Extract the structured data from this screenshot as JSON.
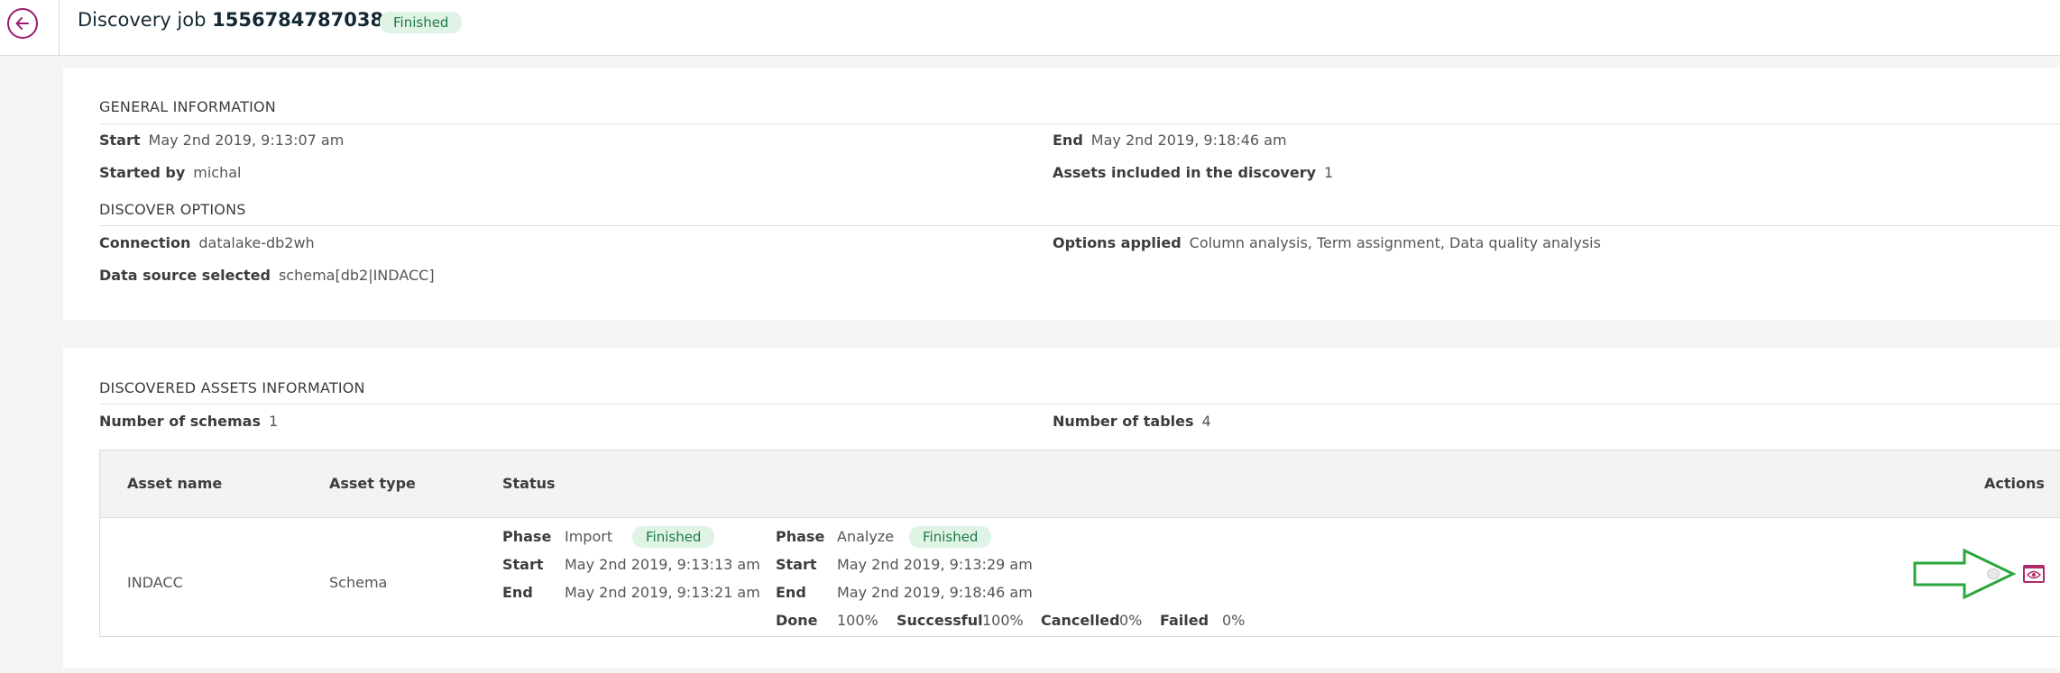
{
  "header": {
    "title_prefix": "Discovery job",
    "job_id": "1556784787038",
    "status": "Finished"
  },
  "general_information": {
    "heading": "GENERAL INFORMATION",
    "start_label": "Start",
    "start_value": "May 2nd 2019, 9:13:07 am",
    "end_label": "End",
    "end_value": "May 2nd 2019, 9:18:46 am",
    "started_by_label": "Started by",
    "started_by_value": "michal",
    "assets_included_label": "Assets included in the discovery",
    "assets_included_value": "1"
  },
  "discover_options": {
    "heading": "DISCOVER OPTIONS",
    "connection_label": "Connection",
    "connection_value": "datalake-db2wh",
    "options_applied_label": "Options applied",
    "options_applied_value": "Column analysis, Term assignment, Data quality analysis",
    "data_source_label": "Data source selected",
    "data_source_value": "schema[db2|INDACC]"
  },
  "discovered_assets": {
    "heading": "DISCOVERED ASSETS INFORMATION",
    "schemas_label": "Number of schemas",
    "schemas_value": "1",
    "tables_label": "Number of tables",
    "tables_value": "4"
  },
  "table": {
    "columns": [
      "Asset name",
      "Asset type",
      "Status",
      "Actions"
    ],
    "rows": [
      {
        "asset_name": "INDACC",
        "asset_type": "Schema",
        "import_phase": {
          "phase_label": "Phase",
          "phase_name": "Import",
          "status": "Finished",
          "start_label": "Start",
          "start_value": "May 2nd 2019, 9:13:13 am",
          "end_label": "End",
          "end_value": "May 2nd 2019, 9:13:21 am"
        },
        "analyze_phase": {
          "phase_label": "Phase",
          "phase_name": "Analyze",
          "status": "Finished",
          "start_label": "Start",
          "start_value": "May 2nd 2019, 9:13:29 am",
          "end_label": "End",
          "end_value": "May 2nd 2019, 9:18:46 am"
        },
        "summary": {
          "done_label": "Done",
          "done_value": "100%",
          "successful_label": "Successful",
          "successful_value": "100%",
          "cancelled_label": "Cancelled",
          "cancelled_value": "0%",
          "failed_label": "Failed",
          "failed_value": "0%"
        },
        "actions": [
          "toggle-icon",
          "view-details-icon"
        ]
      }
    ]
  },
  "icons": {
    "back": "arrow-left-circle-icon",
    "annotation": "green-arrow-icon"
  },
  "colors": {
    "accent": "#9b1b6e",
    "success_bg": "#dff3e6",
    "success_text": "#1f7a45",
    "annotation_arrow": "#2aa63d"
  }
}
